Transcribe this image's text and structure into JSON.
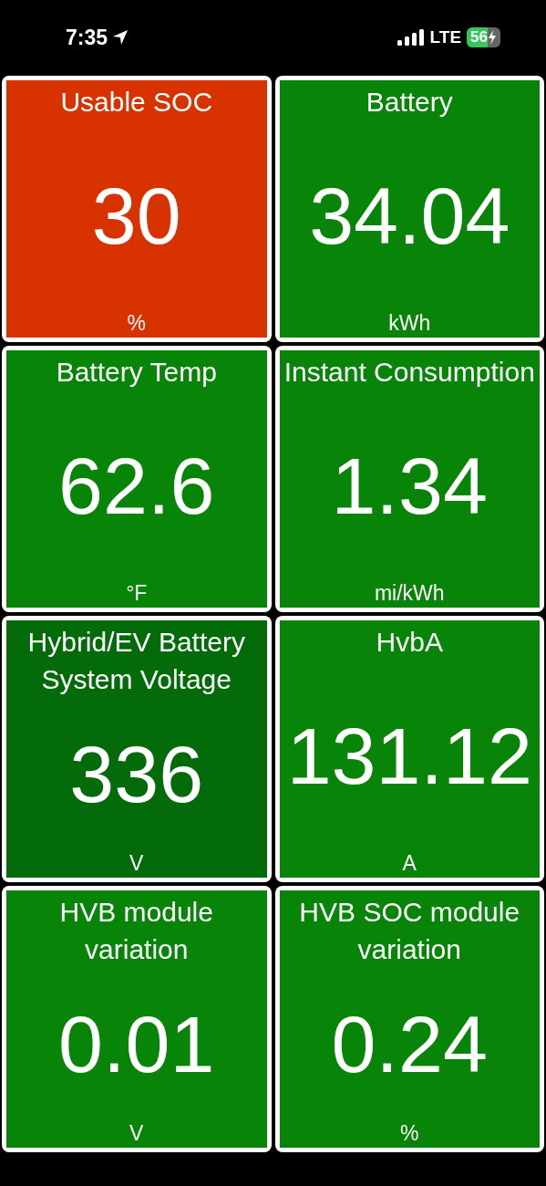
{
  "status_bar": {
    "time": "7:35",
    "network": "LTE",
    "battery": "56"
  },
  "tiles": [
    {
      "title": "Usable SOC",
      "value": "30",
      "unit": "%",
      "color": "#d83200"
    },
    {
      "title": "Battery",
      "value": "34.04",
      "unit": "kWh",
      "color": "#088508"
    },
    {
      "title": "Battery Temp",
      "value": "62.6",
      "unit": "°F",
      "color": "#088508"
    },
    {
      "title": "Instant Consumption",
      "value": "1.34",
      "unit": "mi/kWh",
      "color": "#088508"
    },
    {
      "title": "Hybrid/EV Battery System Voltage",
      "value": "336",
      "unit": "V",
      "color": "#046b0a"
    },
    {
      "title": "HvbA",
      "value": "131.12",
      "unit": "A",
      "color": "#088508"
    },
    {
      "title": "HVB module variation",
      "value": "0.01",
      "unit": "V",
      "color": "#088508"
    },
    {
      "title": "HVB SOC module variation",
      "value": "0.24",
      "unit": "%",
      "color": "#088508"
    }
  ]
}
